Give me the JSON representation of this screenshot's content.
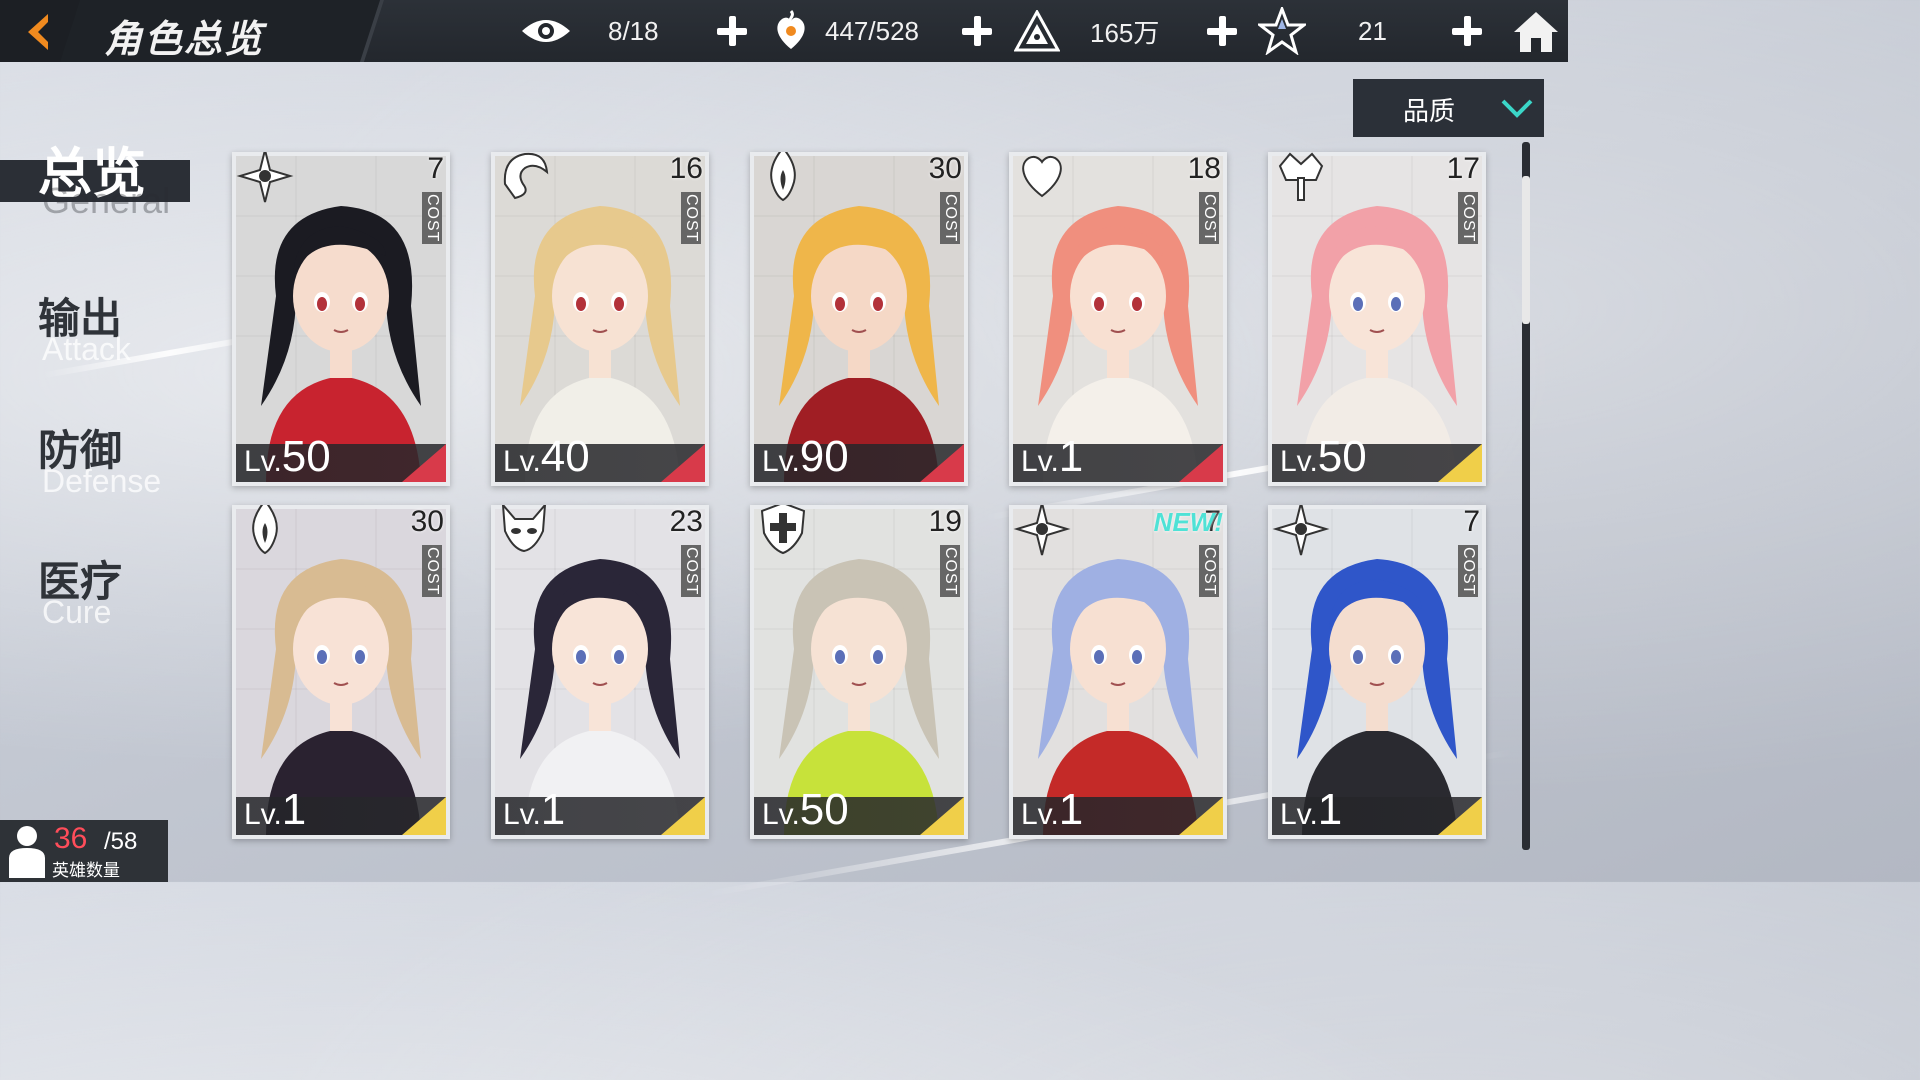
{
  "header": {
    "title": "角色总览",
    "resources": [
      {
        "icon": "eye-icon",
        "value": "8/18"
      },
      {
        "icon": "heart-flame-icon",
        "value": "447/528"
      },
      {
        "icon": "pyramid-icon",
        "value": "165万"
      },
      {
        "icon": "star-shard-icon",
        "value": "21"
      }
    ]
  },
  "sort": {
    "label": "品质"
  },
  "nav": [
    {
      "zh": "总览",
      "en": "General",
      "active": true
    },
    {
      "zh": "输出",
      "en": "Attack",
      "active": false
    },
    {
      "zh": "防御",
      "en": "Defense",
      "active": false
    },
    {
      "zh": "医疗",
      "en": "Cure",
      "active": false
    }
  ],
  "cost_label": "COST",
  "lv_prefix": "Lv.",
  "new_label": "NEW!",
  "cards": [
    {
      "cost": "7",
      "level": "50",
      "class_icon": "shuriken-icon",
      "corner": "#d83a4a",
      "hair": "#1b1b22",
      "outfit": "#c8232f",
      "skin": "#f6dccd",
      "bg": "#d8d8d8"
    },
    {
      "cost": "16",
      "level": "40",
      "class_icon": "dragon-icon",
      "corner": "#d83a4a",
      "hair": "#e7c98d",
      "outfit": "#f1efe8",
      "skin": "#f7e2d3",
      "bg": "#dcdad6"
    },
    {
      "cost": "30",
      "level": "90",
      "class_icon": "flame-icon",
      "corner": "#d83a4a",
      "hair": "#efb64a",
      "outfit": "#a01e24",
      "skin": "#f5d8c6",
      "bg": "#d9d6d3"
    },
    {
      "cost": "18",
      "level": "1",
      "class_icon": "heart-icon",
      "corner": "#d83a4a",
      "hair": "#f08f7e",
      "outfit": "#f4f0ea",
      "skin": "#f8e0d2",
      "bg": "#e3e1de"
    },
    {
      "cost": "17",
      "level": "50",
      "class_icon": "crown-sword-icon",
      "corner": "#f0cf49",
      "hair": "#f2a1a8",
      "outfit": "#f2ece6",
      "skin": "#f8e4d8",
      "bg": "#e6e4e4"
    },
    {
      "cost": "30",
      "level": "1",
      "class_icon": "flame-icon",
      "corner": "#f0cf49",
      "hair": "#d8bb92",
      "outfit": "#2a2230",
      "skin": "#f8e2d6",
      "bg": "#dad7dd"
    },
    {
      "cost": "23",
      "level": "1",
      "class_icon": "fox-mask-icon",
      "corner": "#f0cf49",
      "hair": "#2a2638",
      "outfit": "#f1f1f3",
      "skin": "#f8e4d8",
      "bg": "#e3e2e6"
    },
    {
      "cost": "19",
      "level": "50",
      "class_icon": "cross-shield-icon",
      "corner": "#f0cf49",
      "hair": "#c9c3b5",
      "outfit": "#c7e23a",
      "skin": "#f6e2d4",
      "bg": "#e1e2e0"
    },
    {
      "cost": "7",
      "level": "1",
      "class_icon": "shuriken-icon",
      "corner": "#f0cf49",
      "hair": "#9fb0e3",
      "outfit": "#c42a28",
      "skin": "#f7e0d2",
      "bg": "#e2e0df",
      "is_new": true
    },
    {
      "cost": "7",
      "level": "1",
      "class_icon": "shuriken-icon",
      "corner": "#f0cf49",
      "hair": "#2f56c9",
      "outfit": "#2a2a30",
      "skin": "#f4ddcf",
      "bg": "#dfe2e6"
    }
  ],
  "hero_count": {
    "current": "36",
    "max": "/58",
    "label": "英雄数量"
  },
  "colors": {
    "red_rarity": "#d83a4a",
    "gold_rarity": "#f0cf49",
    "new_badge": "#4fe2d6"
  }
}
